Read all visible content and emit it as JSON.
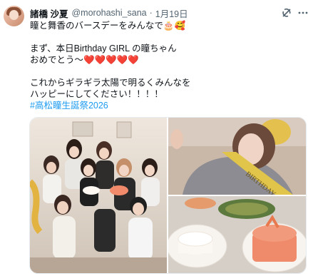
{
  "post": {
    "author_name": "諸橋 沙夏",
    "handle": "@morohashi_sana",
    "separator": "·",
    "date": "1月19日",
    "lines": [
      "瞳と舞香のバースデーをみんなで🎂🥰",
      "",
      "まず、本日Birthday GIRL の瞳ちゃん",
      "おめでとう〜❤️❤️❤️❤️❤️",
      "",
      "これからギラギラ太陽で明るくみんなを",
      "ハッピーにしてください！！！！"
    ],
    "hashtag": "#高松瞳生誕祭2026"
  },
  "icons": {
    "avatar": "avatar",
    "grok": "grok-icon",
    "more": "more-icon"
  },
  "media": {
    "banner_text": "BIRTHDAY",
    "count": 3
  }
}
